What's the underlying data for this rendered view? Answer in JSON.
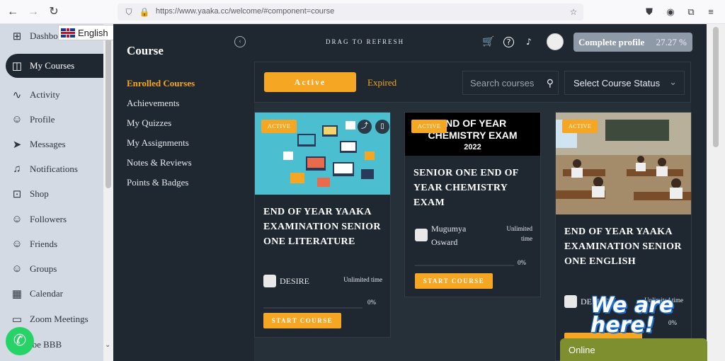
{
  "browser": {
    "url": "https://www.yaaka.cc/welcome/#component=course"
  },
  "language": {
    "selected": "English"
  },
  "sidebar": {
    "items": [
      {
        "label": "Dashboard",
        "icon": "dashboard-icon",
        "glyph": "⊞"
      },
      {
        "label": "My Courses",
        "icon": "courses-icon",
        "glyph": "◫"
      },
      {
        "label": "Activity",
        "icon": "activity-icon",
        "glyph": "∿"
      },
      {
        "label": "Profile",
        "icon": "profile-icon",
        "glyph": "👤"
      },
      {
        "label": "Messages",
        "icon": "messages-icon",
        "glyph": "➤"
      },
      {
        "label": "Notifications",
        "icon": "bell-icon",
        "glyph": "🔔"
      },
      {
        "label": "Shop",
        "icon": "shop-icon",
        "glyph": "🛍"
      },
      {
        "label": "Followers",
        "icon": "followers-icon",
        "glyph": "👥"
      },
      {
        "label": "Friends",
        "icon": "friends-icon",
        "glyph": "👤"
      },
      {
        "label": "Groups",
        "icon": "groups-icon",
        "glyph": "👥"
      },
      {
        "label": "Calendar",
        "icon": "calendar-icon",
        "glyph": "📅"
      },
      {
        "label": "Zoom Meetings",
        "icon": "video-icon",
        "glyph": "🎥"
      },
      {
        "label": "ibe BBB",
        "icon": "bbb-icon",
        "glyph": ""
      }
    ]
  },
  "course": {
    "title": "Course",
    "menu": [
      "Enrolled Courses",
      "Achievements",
      "My Quizzes",
      "My Assignments",
      "Notes & Reviews",
      "Points & Badges"
    ]
  },
  "header": {
    "drag": "DRAG TO REFRESH",
    "profile_label": "Complete profile",
    "profile_pct": "27.27 %"
  },
  "filters": {
    "active": "Active",
    "expired": "Expired",
    "search_placeholder": "Search courses",
    "status": "Select Course Status"
  },
  "cards": [
    {
      "badge": "ACTIVE",
      "title": "END OF YEAR YAAKA EXAMINATION SENIOR ONE LITERATURE",
      "author": "DESIRE",
      "time": "Unlimited time",
      "pct": "0%",
      "start": "START COURSE"
    },
    {
      "badge": "ACTIVE",
      "title": "SENIOR ONE END OF YEAR CHEMISTRY EXAM",
      "author": "Mugumya Osward",
      "time": "Unlimited time",
      "pct": "0%",
      "start": "START COURSE",
      "img_line1": "END OF YEAR",
      "img_line2": "CHEMISTRY EXAM",
      "img_line3": "2022"
    },
    {
      "badge": "ACTIVE",
      "title": "END OF YEAR YAAKA EXAMINATION SENIOR ONE ENGLISH",
      "author": "DESIRE",
      "time": "Unlimited time",
      "pct": "0%",
      "start": "START COURSE"
    }
  ],
  "widgets": {
    "online": "Online",
    "we_are_here": "We are here!"
  }
}
